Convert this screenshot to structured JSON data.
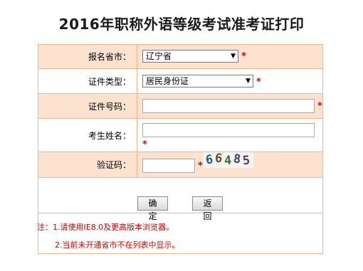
{
  "title": "2016年职称外语等级考试准考证打印",
  "form": {
    "province": {
      "label": "报名省市：",
      "value": "辽宁省",
      "required_mark": "*"
    },
    "id_type": {
      "label": "证件类型：",
      "value": "居民身份证",
      "required_mark": "*"
    },
    "id_number": {
      "label": "证件号码：",
      "value": "",
      "required_mark": "*"
    },
    "name": {
      "label": "考生姓名：",
      "value": "",
      "required_mark": "*"
    },
    "captcha": {
      "label": "验证码：",
      "value": "",
      "required_mark": "*",
      "image_text": [
        "6",
        "6",
        "4",
        "8",
        "5"
      ]
    }
  },
  "buttons": {
    "confirm": "确 定",
    "back": "返 回"
  },
  "notes": {
    "line1": "注：1.请使用IE8.0及更高版本浏览器。",
    "line2": "2.当前未开通省市不在列表中显示。"
  },
  "colors": {
    "row_highlight": "#fde3cf",
    "border": "#f2b48a",
    "required": "#e00000"
  }
}
